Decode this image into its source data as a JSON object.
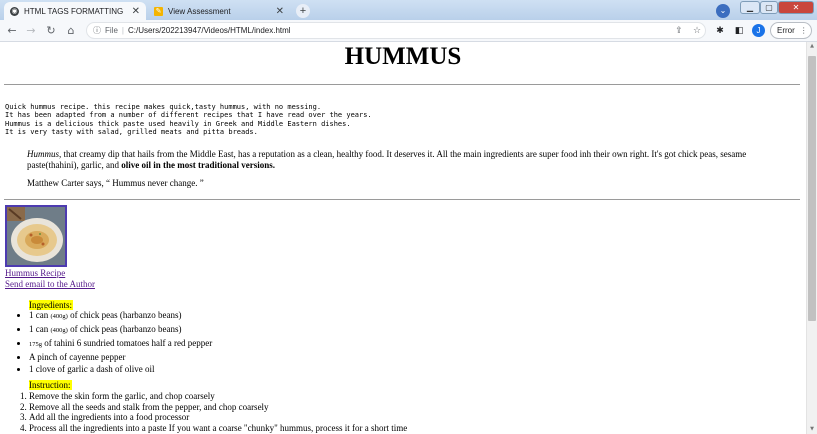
{
  "browser": {
    "tabs": [
      {
        "title": "HTML TAGS FORMATTING",
        "active": true
      },
      {
        "title": "View Assessment",
        "active": false
      }
    ],
    "new_tab": "+",
    "url_scheme": "File",
    "url": "C:/Users/202213947/Videos/HTML/index.html",
    "profile_initial": "J",
    "error_label": "Error"
  },
  "page": {
    "title": "HUMMUS",
    "intro_lines": [
      "Quick hummus recipe. this recipe makes quick,tasty hummus, with no messing.",
      "It has been adapted from a number of different recipes that I have read over the years.",
      "Hummus is a delicious thick paste used heavily in Greek and Middle Eastern dishes.",
      "It is very tasty with salad, grilled meats and pitta breads."
    ],
    "desc": {
      "em": "Hummus,",
      "text": " that creamy dip that hails from the Middle East, has a reputation as a clean, healthy food. It deserves it. All the main ingredients are super food inh their own right. It's got chick peas, sesame paste(thahini), garlic, and ",
      "strong": "olive oil in the most traditional versions."
    },
    "quote": "Matthew Carter says, “ Hummus never change. ”",
    "links": {
      "recipe": "Hummus Recipe",
      "email": "Send email to the Author"
    },
    "ingredients_label": "Ingredients:",
    "ingredients": [
      {
        "pre": "1 can ",
        "small": "(400g)",
        "post": " of chick peas (harbanzo beans)"
      },
      {
        "pre": "1 can ",
        "small": "(400g)",
        "post": " of chick peas (harbanzo beans)"
      },
      {
        "pre": "",
        "small": "175g",
        "post": " of tahini 6 sundried tomatoes half a red pepper"
      },
      {
        "pre": "A pinch of cayenne pepper",
        "small": "",
        "post": ""
      },
      {
        "pre": "1 clove of garlic a dash of olive oil",
        "small": "",
        "post": ""
      }
    ],
    "instructions_label": "Instruction:",
    "instructions": [
      "Remove the skin form the garlic, and chop coarsely",
      "Remove all the seeds and stalk from the pepper, and chop coarsely",
      "Add all the ingredients into a food processor",
      "Process all the ingredients into a paste If you want a coarse \"chunky\" hummus, process it for a short time"
    ]
  },
  "colors": {
    "highlight": "#ffff00",
    "visited_link": "#551a8b",
    "image_border": "#4d3bb0"
  },
  "icons": [
    "chrome-globe-icon",
    "assessment-icon",
    "close-icon",
    "plus-icon",
    "back-icon",
    "forward-icon",
    "reload-icon",
    "home-icon",
    "info-icon",
    "share-icon",
    "star-icon",
    "extensions-icon",
    "sidepanel-icon",
    "kebab-icon",
    "tab-search-icon",
    "minimize-icon",
    "maximize-icon",
    "window-close-icon"
  ]
}
